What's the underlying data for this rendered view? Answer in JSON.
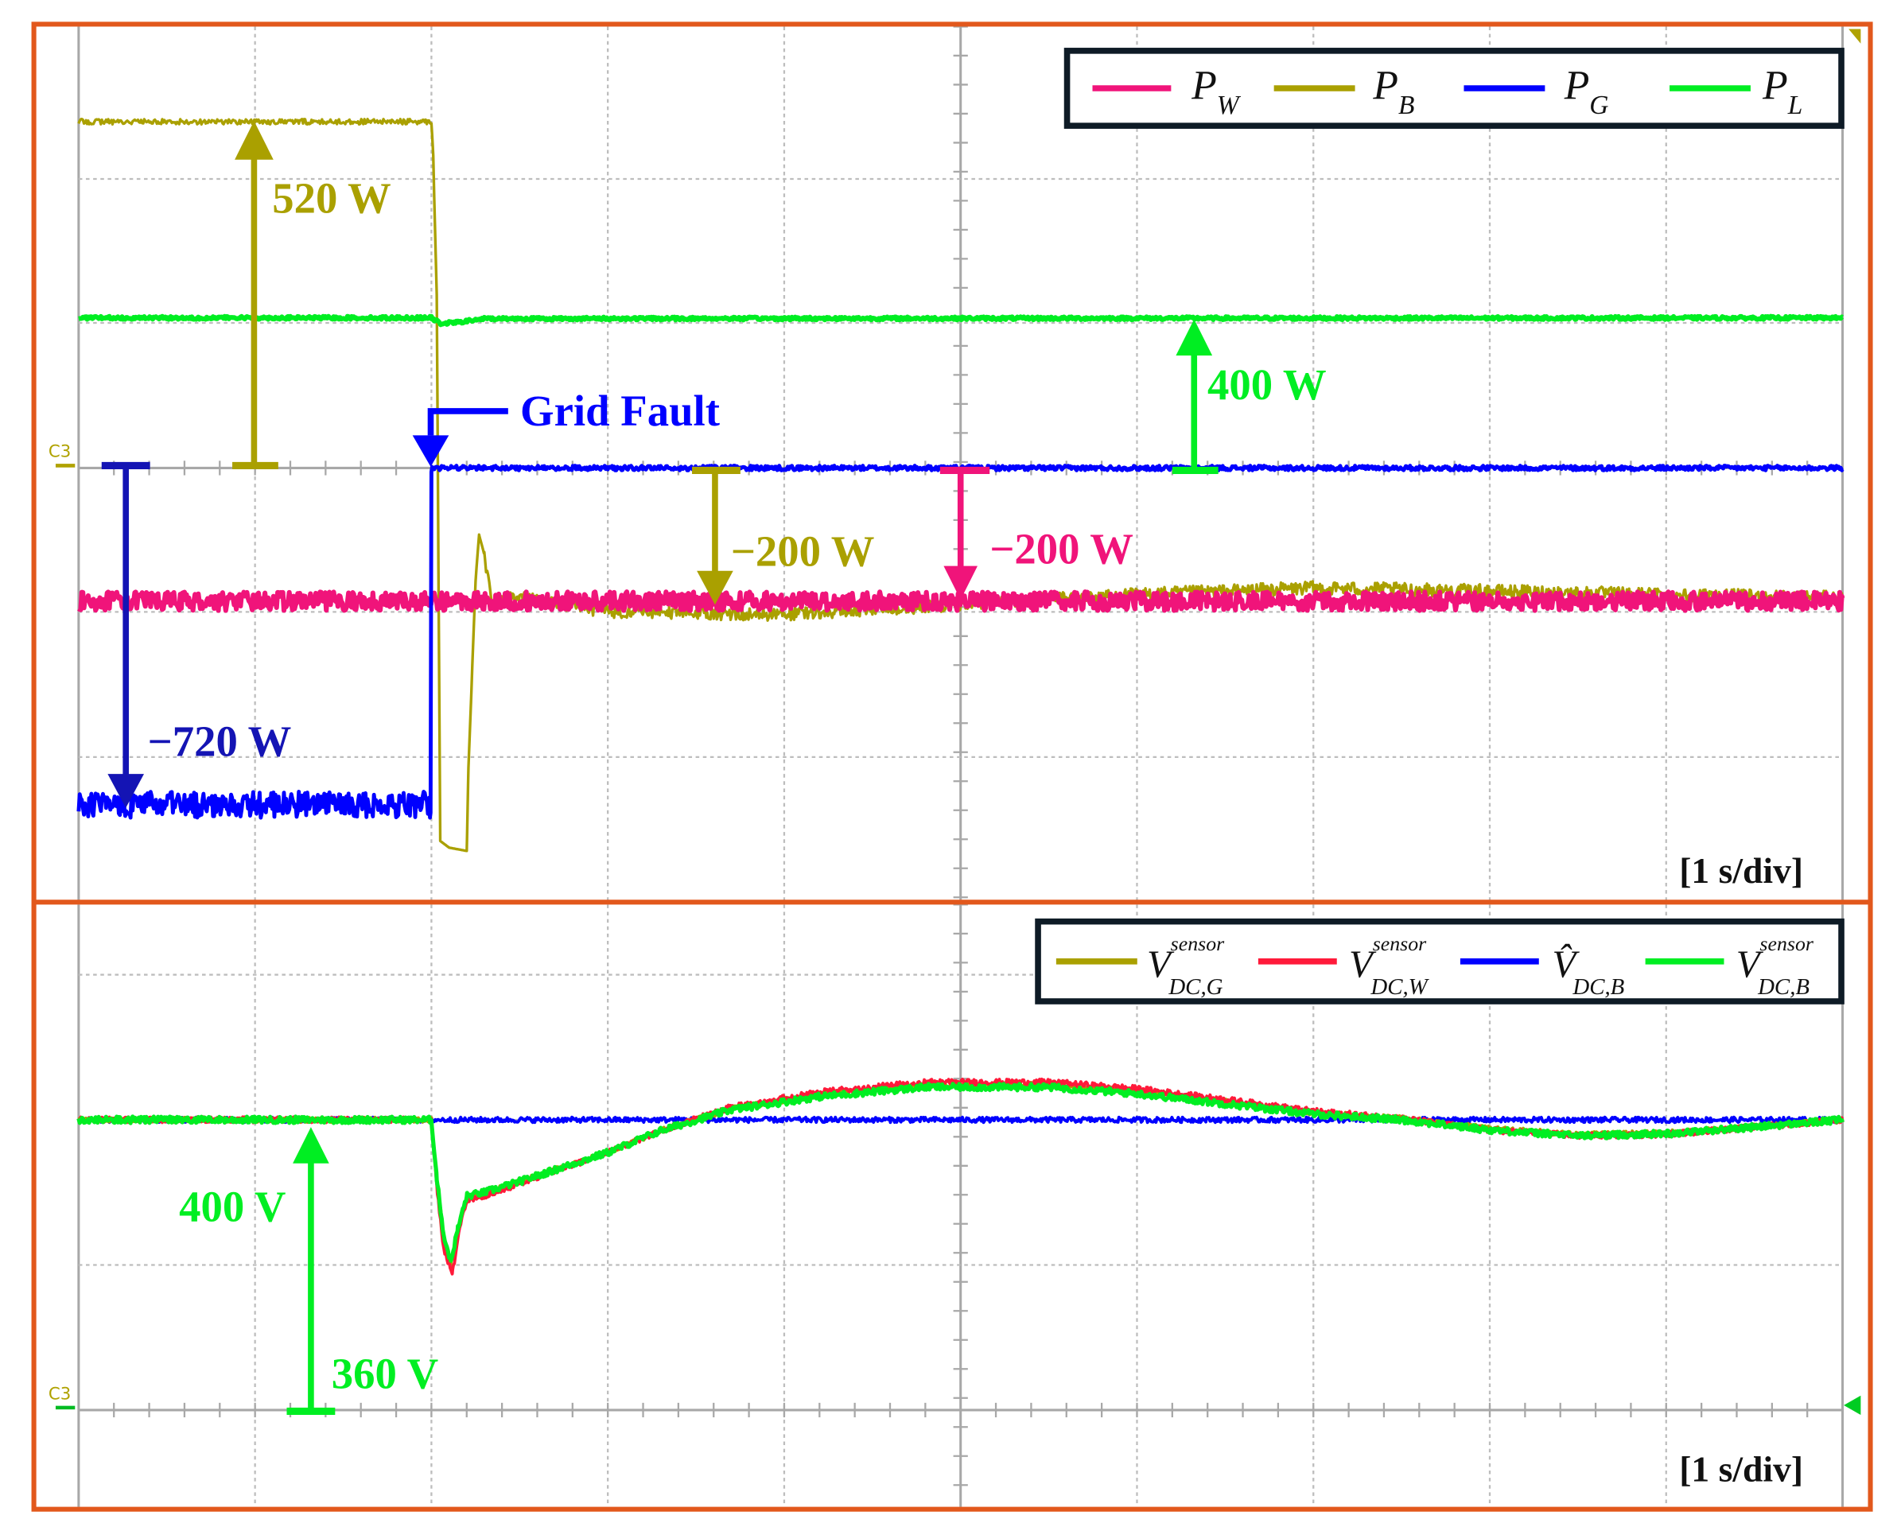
{
  "chart_data": [
    {
      "type": "line",
      "title": "Power waveforms",
      "xlabel": "[1 s/div]",
      "time_per_div_s": 1,
      "x_range_s": [
        0,
        10
      ],
      "divisions_vertical": 6,
      "grid": true,
      "legend_placement": "top-right",
      "series": [
        {
          "name": "P_W",
          "symbol": "P",
          "sub": "W",
          "color": "#f0147a",
          "w_per_div": 217,
          "noise": [
            [
              0,
              10,
              14
            ]
          ],
          "points": [
            [
              0,
              -200
            ],
            [
              10,
              -200
            ]
          ]
        },
        {
          "name": "P_B",
          "symbol": "P",
          "sub": "B",
          "color": "#aaa000",
          "w_per_div": 217,
          "noise": [
            [
              0,
              2,
              4
            ],
            [
              2.3,
              10,
              10
            ]
          ],
          "points": [
            [
              0,
              520
            ],
            [
              2.0,
              520
            ],
            [
              2.01,
              470
            ],
            [
              2.03,
              260
            ],
            [
              2.05,
              -560
            ],
            [
              2.1,
              -570
            ],
            [
              2.2,
              -575
            ],
            [
              2.21,
              -450
            ],
            [
              2.25,
              -170
            ],
            [
              2.27,
              -100
            ],
            [
              2.3,
              -130
            ],
            [
              2.34,
              -200
            ],
            [
              2.5,
              -195
            ],
            [
              3,
              -215
            ],
            [
              4,
              -220
            ],
            [
              5,
              -205
            ],
            [
              6,
              -190
            ],
            [
              7,
              -180
            ],
            [
              8,
              -185
            ],
            [
              9,
              -190
            ],
            [
              10,
              -195
            ]
          ]
        },
        {
          "name": "P_L",
          "symbol": "P",
          "sub": "L",
          "color": "#00ee22",
          "w_per_div": 385,
          "noise": [
            [
              0,
              10,
              4
            ]
          ],
          "points": [
            [
              0,
              400
            ],
            [
              2.0,
              400
            ],
            [
              2.05,
              385
            ],
            [
              2.15,
              388
            ],
            [
              2.3,
              398
            ],
            [
              10,
              400
            ]
          ]
        },
        {
          "name": "P_G",
          "symbol": "P",
          "sub": "G",
          "color": "#0000ff",
          "w_per_div": 309,
          "noise": [
            [
              0,
              2,
              28
            ],
            [
              2,
              10,
              5
            ]
          ],
          "points": [
            [
              0,
              -720
            ],
            [
              1.995,
              -720
            ],
            [
              2.0,
              0
            ],
            [
              10,
              0
            ]
          ]
        }
      ],
      "annotations": {
        "pb_initial": "520 W",
        "pl": "400 W",
        "pb_final": "−200 W",
        "pw": "−200 W",
        "pg_initial": "−720 W",
        "fault": "Grid Fault",
        "channel_marker": "C3"
      }
    },
    {
      "type": "line",
      "title": "DC-link voltages",
      "xlabel": "[1 s/div]",
      "time_per_div_s": 1,
      "x_range_s": [
        0,
        10
      ],
      "volts_per_div": 20,
      "offset_v": 360,
      "grid": true,
      "legend_placement": "top-right",
      "series": [
        {
          "name": "V_hat_DC,B",
          "symbol": "V̂",
          "sup": "",
          "sub": "DC,B",
          "color": "#0000ff",
          "noise": [
            [
              0,
              10,
              0.35
            ]
          ],
          "points": [
            [
              0,
              400
            ],
            [
              10,
              400
            ]
          ]
        },
        {
          "name": "V_DC,G^sensor",
          "symbol": "V",
          "sup": "sensor",
          "sub": "DC,G",
          "color": "#aaa000",
          "noise": [
            [
              0,
              10,
              0.35
            ]
          ],
          "points": [
            [
              0,
              400
            ],
            [
              2.0,
              400
            ],
            [
              2.03,
              392
            ],
            [
              2.07,
              384
            ],
            [
              2.11,
              380
            ],
            [
              2.15,
              385
            ],
            [
              2.2,
              389
            ],
            [
              2.3,
              390
            ],
            [
              2.5,
              391.5
            ],
            [
              3,
              395.5
            ],
            [
              3.3,
              398.5
            ],
            [
              3.7,
              401.5
            ],
            [
              4.2,
              403.5
            ],
            [
              4.8,
              404.8
            ],
            [
              5.5,
              404.8
            ],
            [
              6,
              404
            ],
            [
              6.5,
              402.5
            ],
            [
              7,
              401
            ],
            [
              7.5,
              400.2
            ],
            [
              8,
              398.8
            ],
            [
              8.5,
              398
            ],
            [
              9,
              398.2
            ],
            [
              9.5,
              399
            ],
            [
              10,
              400
            ]
          ]
        },
        {
          "name": "V_DC,W^sensor",
          "symbol": "V",
          "sup": "sensor",
          "sub": "DC,W",
          "color": "#ff1a3a",
          "noise": [
            [
              0,
              10,
              0.4
            ]
          ],
          "points": [
            [
              0,
              400
            ],
            [
              2.0,
              400
            ],
            [
              2.03,
              391
            ],
            [
              2.07,
              382
            ],
            [
              2.12,
              379
            ],
            [
              2.16,
              385
            ],
            [
              2.2,
              389
            ],
            [
              2.3,
              389.5
            ],
            [
              2.5,
              391.2
            ],
            [
              3,
              395.5
            ],
            [
              3.3,
              398.5
            ],
            [
              3.7,
              401.8
            ],
            [
              4.2,
              403.8
            ],
            [
              4.8,
              405.2
            ],
            [
              5.5,
              405.2
            ],
            [
              6,
              404.3
            ],
            [
              6.5,
              402.8
            ],
            [
              7,
              401.2
            ],
            [
              7.5,
              400.2
            ],
            [
              8,
              398.6
            ],
            [
              8.5,
              397.8
            ],
            [
              9,
              398
            ],
            [
              9.5,
              399
            ],
            [
              10,
              400
            ]
          ]
        },
        {
          "name": "V_DC,B^sensor",
          "symbol": "V",
          "sup": "sensor",
          "sub": "DC,B",
          "color": "#00ee22",
          "noise": [
            [
              0,
              10,
              0.45
            ]
          ],
          "points": [
            [
              0,
              400
            ],
            [
              2.0,
              400
            ],
            [
              2.03,
              392
            ],
            [
              2.07,
              384
            ],
            [
              2.11,
              380.5
            ],
            [
              2.15,
              385
            ],
            [
              2.2,
              389.5
            ],
            [
              2.3,
              390
            ],
            [
              2.5,
              391.5
            ],
            [
              3,
              395.5
            ],
            [
              3.3,
              398.5
            ],
            [
              3.7,
              401.4
            ],
            [
              4.2,
              403.2
            ],
            [
              4.8,
              404.5
            ],
            [
              5.5,
              404.5
            ],
            [
              6,
              403.6
            ],
            [
              6.5,
              402.2
            ],
            [
              7,
              400.8
            ],
            [
              7.5,
              400
            ],
            [
              8,
              398.6
            ],
            [
              8.5,
              397.8
            ],
            [
              9,
              398.1
            ],
            [
              9.5,
              399
            ],
            [
              10,
              400
            ]
          ]
        }
      ],
      "annotations": {
        "level": "400 V",
        "offset": "360 V",
        "channel_marker": "C3"
      }
    }
  ]
}
